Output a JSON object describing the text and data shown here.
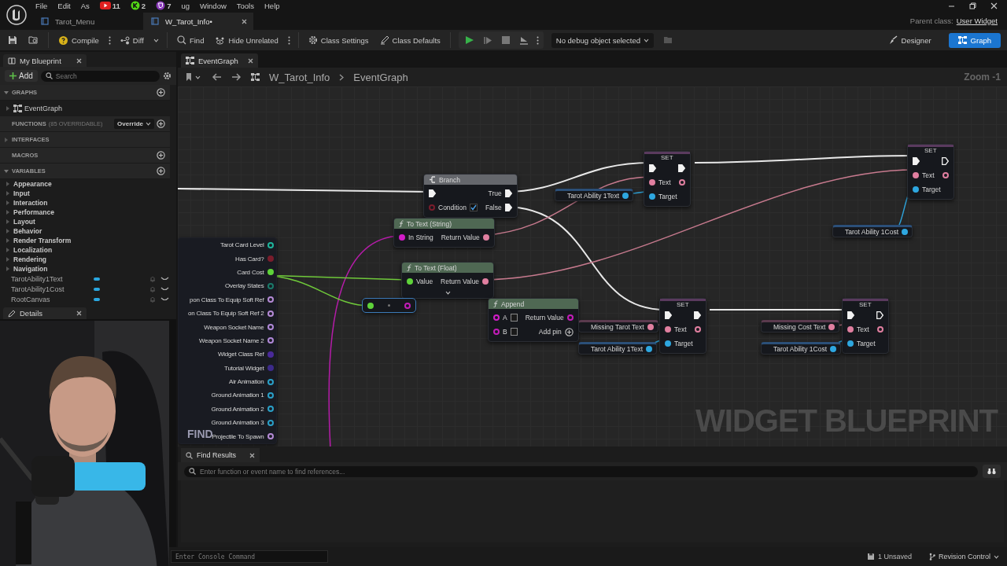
{
  "menu": [
    "File",
    "Edit",
    "As"
  ],
  "stream_badges": [
    {
      "kind": "youtube",
      "count": "11"
    },
    {
      "kind": "kick",
      "count": "2"
    },
    {
      "kind": "twitch",
      "count": "7"
    }
  ],
  "menu_rest": [
    "ug",
    "Window",
    "Tools",
    "Help"
  ],
  "doc_tabs": [
    {
      "label": "Tarot_Menu",
      "selected": false
    },
    {
      "label": "W_Tarot_Info•",
      "selected": true
    }
  ],
  "parent_class": {
    "label": "Parent class:",
    "value": "User Widget"
  },
  "toolbar": {
    "compile": "Compile",
    "diff": "Diff",
    "find": "Find",
    "hide_unrelated": "Hide Unrelated",
    "class_settings": "Class Settings",
    "class_defaults": "Class Defaults",
    "debug_filter": "No debug object selected"
  },
  "modes": [
    {
      "label": "Designer",
      "selected": false
    },
    {
      "label": "Graph",
      "selected": true
    }
  ],
  "my_blueprint": {
    "title": "My Blueprint",
    "add": "Add",
    "search_placeholder": "Search",
    "sections": [
      {
        "title": "GRAPHS",
        "expanded": true,
        "addable": true,
        "items": [
          "EventGraph"
        ]
      },
      {
        "title": "FUNCTIONS",
        "note": "(85 OVERRIDABLE)",
        "button": "Override",
        "addable": true
      },
      {
        "title": "INTERFACES",
        "expanded": false,
        "addable": false
      },
      {
        "title": "MACROS",
        "addable": true
      },
      {
        "title": "VARIABLES",
        "expanded": true,
        "addable": true
      }
    ],
    "categories": [
      {
        "label": "Appearance",
        "expanded": false
      },
      {
        "label": "Input",
        "expanded": false
      },
      {
        "label": "Interaction",
        "expanded": false
      },
      {
        "label": "Performance",
        "expanded": false
      },
      {
        "label": "Layout",
        "expanded": false
      },
      {
        "label": "Behavior",
        "expanded": false
      },
      {
        "label": "Render Transform",
        "expanded": false
      },
      {
        "label": "Localization",
        "expanded": false
      },
      {
        "label": "Rendering",
        "expanded": false
      },
      {
        "label": "Navigation",
        "expanded": false
      }
    ],
    "variables": [
      "TarotAbility1Text",
      "TarotAbility1Cost",
      "RootCanvas"
    ]
  },
  "details_tab": "Details",
  "graph": {
    "tab": "EventGraph",
    "breadcrumb": [
      "W_Tarot_Info",
      "EventGraph"
    ],
    "zoom": "Zoom -1",
    "label": "WIDGET BLUEPRINT",
    "overlay_text": "FIND",
    "nodes": [
      {
        "kind": "variables",
        "outputs": [
          {
            "kind": "data",
            "label": "Tarot Card Level",
            "color": "#1fb59c",
            "connected": false
          },
          {
            "kind": "data",
            "label": "Has Card?",
            "color": "#7a1d2c",
            "connected": true
          },
          {
            "kind": "data",
            "label": "Card Cost",
            "color": "#5fd33a",
            "connected": true
          },
          {
            "kind": "data",
            "label": "Overlay States",
            "color": "#1a7a6a",
            "connected": false
          },
          {
            "kind": "data",
            "label": "pon Class To Equip Soft Ref",
            "color": "#b58ad6",
            "connected": false
          },
          {
            "kind": "data",
            "label": "on Class To Equip Soft Ref 2",
            "color": "#b58ad6",
            "connected": false
          },
          {
            "kind": "data",
            "label": "Weapon Socket Name",
            "color": "#b088d8",
            "connected": false
          },
          {
            "kind": "data",
            "label": "Weapon Socket Name 2",
            "color": "#b088d8",
            "connected": false
          },
          {
            "kind": "data",
            "label": "Widget Class Ref",
            "color": "#4a2a9a",
            "connected": true
          },
          {
            "kind": "data",
            "label": "Tutorial Widget",
            "color": "#3c2a8a",
            "connected": true
          },
          {
            "kind": "data",
            "label": "Air Animation",
            "color": "#2aa0c8",
            "connected": false
          },
          {
            "kind": "data",
            "label": "Ground Animation 1",
            "color": "#2aa0c8",
            "connected": false
          },
          {
            "kind": "data",
            "label": "Ground Animation 2",
            "color": "#2aa0c8",
            "connected": false
          },
          {
            "kind": "data",
            "label": "Ground Animation 3",
            "color": "#2aa0c8",
            "connected": false
          },
          {
            "kind": "data",
            "label": "Projectile To Spawn",
            "color": "#b58ad6",
            "connected": false
          }
        ]
      },
      {
        "kind": "branch",
        "title": "Branch",
        "inputs": [
          {
            "kind": "exec",
            "connected": true
          },
          {
            "kind": "bool",
            "label": "Condition",
            "color": "#7a1d2c",
            "connected": false,
            "checked": true
          }
        ],
        "outputs": [
          {
            "kind": "exec",
            "label": "True",
            "connected": true
          },
          {
            "kind": "exec",
            "label": "False",
            "connected": true
          }
        ]
      },
      {
        "kind": "function",
        "title": "To Text (String)",
        "inputs": [
          {
            "kind": "data",
            "label": "In String",
            "color": "#d21cc8",
            "connected": true
          }
        ],
        "outputs": [
          {
            "kind": "data",
            "label": "Return Value",
            "color": "#e07fa0",
            "connected": true
          }
        ]
      },
      {
        "kind": "function",
        "title": "To Text (Float)",
        "expandable": true,
        "inputs": [
          {
            "kind": "data",
            "label": "Value",
            "color": "#5fd33a",
            "connected": true
          }
        ],
        "outputs": [
          {
            "kind": "data",
            "label": "Return Value",
            "color": "#e07fa0",
            "connected": true
          }
        ]
      },
      {
        "kind": "reroute",
        "inputs": [
          {
            "kind": "data",
            "color": "#5fd33a",
            "connected": true
          }
        ],
        "outputs": [
          {
            "kind": "data",
            "color": "#c21cb8",
            "connected": false
          }
        ]
      },
      {
        "kind": "function",
        "title": "Append",
        "inputs": [
          {
            "kind": "data",
            "label": "A",
            "color": "#d21cc8",
            "connected": false,
            "field": true
          },
          {
            "kind": "data",
            "label": "B",
            "color": "#c21cb8",
            "connected": false,
            "field": true
          }
        ],
        "outputs": [
          {
            "kind": "data",
            "label": "Return Value",
            "color": "#c21cb8",
            "connected": false
          },
          {
            "kind": "add",
            "label": "Add pin"
          }
        ]
      },
      {
        "kind": "set",
        "title": "SET",
        "inputs": [
          {
            "kind": "exec",
            "connected": true
          },
          {
            "kind": "data",
            "label": "Text",
            "color": "#e07fa0",
            "connected": true
          },
          {
            "kind": "data",
            "label": "Target",
            "color": "#2ea7e0",
            "connected": true
          }
        ],
        "outputs": [
          {
            "kind": "exec",
            "connected": true
          },
          {
            "kind": "data",
            "color": "#e07fa0",
            "connected": false
          }
        ]
      },
      {
        "kind": "set",
        "title": "SET",
        "inputs": [
          {
            "kind": "exec",
            "connected": true
          },
          {
            "kind": "data",
            "label": "Text",
            "color": "#e07fa0",
            "connected": true
          },
          {
            "kind": "data",
            "label": "Target",
            "color": "#2ea7e0",
            "connected": true
          }
        ],
        "outputs": [
          {
            "kind": "exec",
            "connected": false
          },
          {
            "kind": "data",
            "color": "#e07fa0",
            "connected": false
          }
        ]
      },
      {
        "kind": "set",
        "title": "SET",
        "inputs": [
          {
            "kind": "exec",
            "connected": true
          },
          {
            "kind": "data",
            "label": "Text",
            "color": "#e07fa0",
            "connected": true
          },
          {
            "kind": "data",
            "label": "Target",
            "color": "#2ea7e0",
            "connected": true
          }
        ],
        "outputs": [
          {
            "kind": "exec",
            "connected": true
          },
          {
            "kind": "data",
            "color": "#e07fa0",
            "connected": false
          }
        ]
      },
      {
        "kind": "set",
        "title": "SET",
        "inputs": [
          {
            "kind": "exec",
            "connected": true
          },
          {
            "kind": "data",
            "label": "Text",
            "color": "#e07fa0",
            "connected": true
          },
          {
            "kind": "data",
            "label": "Target",
            "color": "#2ea7e0",
            "connected": true
          }
        ],
        "outputs": [
          {
            "kind": "exec",
            "connected": false
          },
          {
            "kind": "data",
            "color": "#e07fa0",
            "connected": false
          }
        ]
      },
      {
        "kind": "getter",
        "outputs": [
          {
            "kind": "data",
            "label": "Tarot Ability 1Text",
            "color": "#2ea7e0",
            "connected": true
          }
        ]
      },
      {
        "kind": "getter",
        "outputs": [
          {
            "kind": "data",
            "label": "Tarot Ability 1Cost",
            "color": "#2ea7e0",
            "connected": true
          }
        ]
      },
      {
        "kind": "getter",
        "outputs": [
          {
            "kind": "data",
            "label": "Missing Tarot Text",
            "color": "#e07fa0",
            "connected": true
          }
        ]
      },
      {
        "kind": "getter",
        "outputs": [
          {
            "kind": "data",
            "label": "Tarot Ability 1Text",
            "color": "#2ea7e0",
            "connected": true
          }
        ]
      },
      {
        "kind": "getter",
        "outputs": [
          {
            "kind": "data",
            "label": "Missing Cost Text",
            "color": "#e07fa0",
            "connected": true
          }
        ]
      },
      {
        "kind": "getter",
        "outputs": [
          {
            "kind": "data",
            "label": "Tarot Ability 1Cost",
            "color": "#2ea7e0",
            "connected": true
          }
        ]
      }
    ]
  },
  "find_results": {
    "title": "Find Results",
    "placeholder": "Enter function or event name to find references..."
  },
  "status_bar": {
    "console_placeholder": "Enter Console Command",
    "unsaved": "1 Unsaved",
    "revision_control": "Revision Control"
  },
  "webcam": {
    "kind": "picture"
  }
}
